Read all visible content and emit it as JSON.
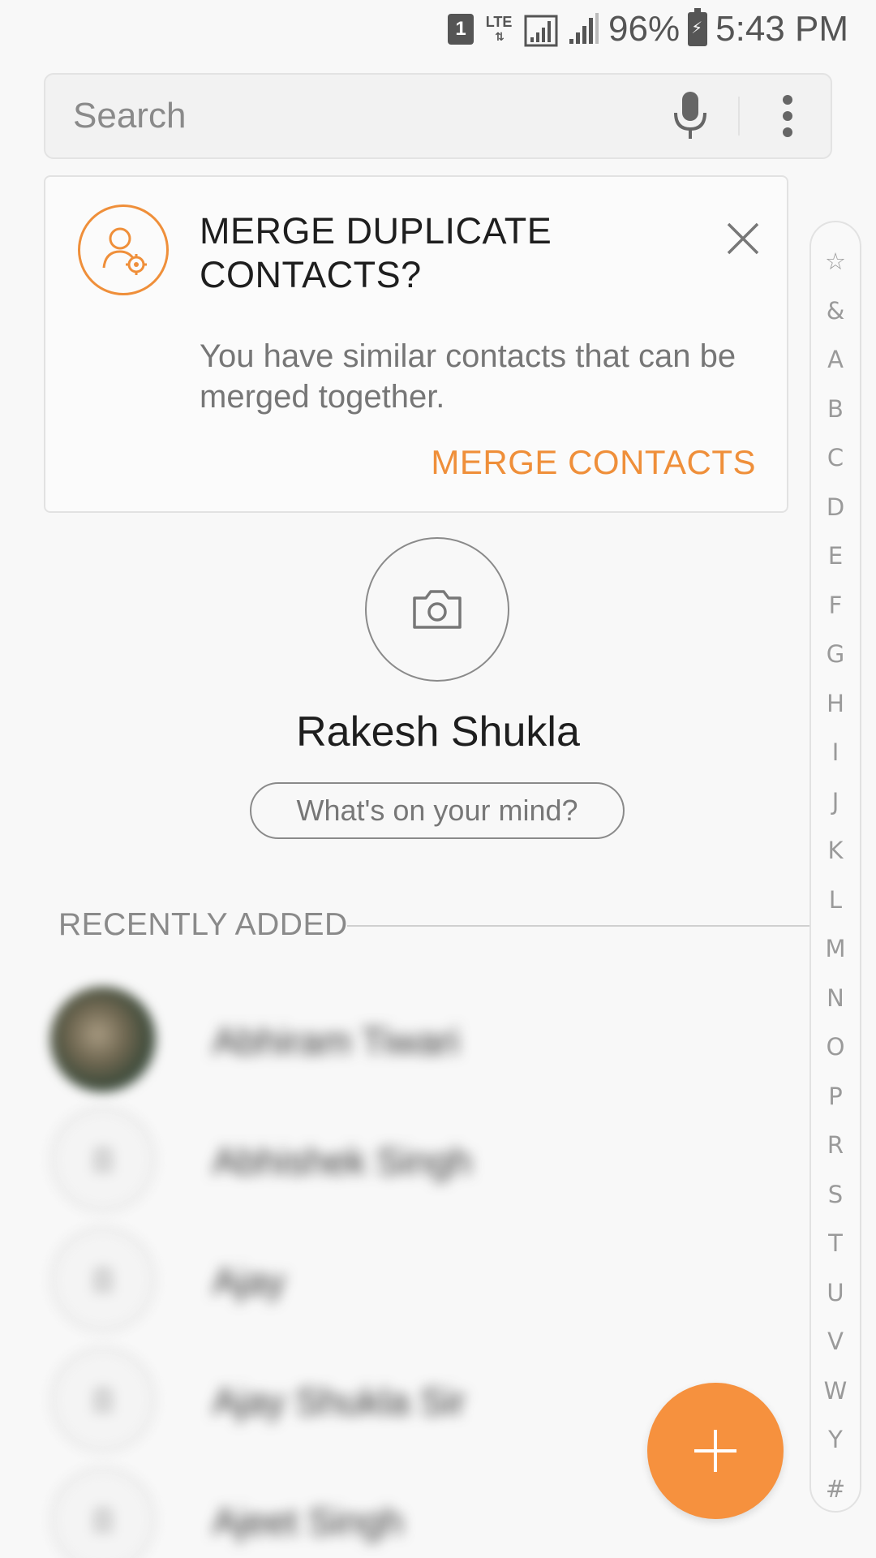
{
  "status_bar": {
    "sim_badge": "1",
    "network_type": "LTE",
    "battery_percent": "96%",
    "time": "5:43 PM"
  },
  "search": {
    "placeholder": "Search"
  },
  "merge_card": {
    "title": "MERGE DUPLICATE CONTACTS?",
    "description": "You have similar contacts that can be merged together.",
    "action_label": "MERGE CONTACTS"
  },
  "profile": {
    "name": "Rakesh Shukla",
    "status_prompt": "What's on your mind?"
  },
  "recently_added": {
    "header": "RECENTLY ADDED",
    "contacts": [
      {
        "name": "Abhiram Tiwari",
        "avatar": "photo"
      },
      {
        "name": "Abhishek Singh",
        "avatar": "placeholder"
      },
      {
        "name": "Ajay",
        "avatar": "placeholder"
      },
      {
        "name": "Ajay Shukla Sir",
        "avatar": "placeholder"
      },
      {
        "name": "Ajeet Singh",
        "avatar": "placeholder"
      }
    ]
  },
  "index": {
    "letters": [
      "☆",
      "&",
      "A",
      "B",
      "C",
      "D",
      "E",
      "F",
      "G",
      "H",
      "I",
      "J",
      "K",
      "L",
      "M",
      "N",
      "O",
      "P",
      "R",
      "S",
      "T",
      "U",
      "V",
      "W",
      "Y",
      "#"
    ]
  },
  "colors": {
    "accent": "#ef8f3a",
    "fab": "#f6913e",
    "background": "#f8f8f8"
  },
  "icons": {
    "mic": "mic-icon",
    "more": "more-vert-icon",
    "merge": "merge-contacts-icon",
    "close": "close-icon",
    "camera": "camera-icon",
    "add": "plus-icon"
  }
}
